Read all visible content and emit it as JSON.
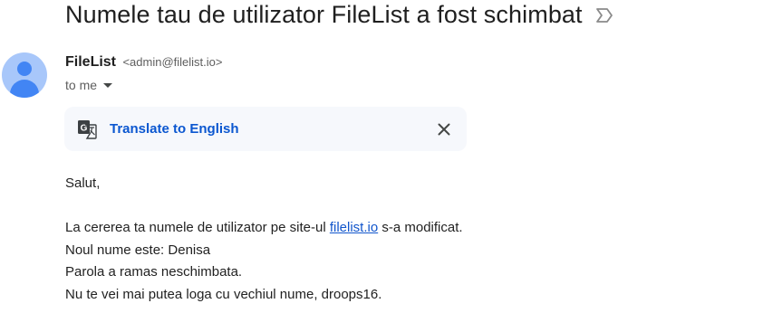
{
  "email": {
    "subject": "Numele tau de utilizator FileList a fost schimbat",
    "label_icon": "label-important-outline-icon",
    "sender": {
      "name": "FileList",
      "email": "<admin@filelist.io>",
      "avatar_icon": "default-person-avatar"
    },
    "recipient": "to me",
    "translate": {
      "icon": "translate-icon",
      "label": "Translate to English",
      "close_icon": "close-icon"
    },
    "body": {
      "greeting": "Salut,",
      "line1_before": "La cererea ta numele de utilizator pe site-ul ",
      "line1_link": "filelist.io",
      "line1_after": " s-a modificat.",
      "line2": "Noul nume este: Denisa",
      "line3": "Parola a ramas neschimbata.",
      "line4": "Nu te vei mai putea loga cu vechiul nume, droops16."
    }
  },
  "colors": {
    "link": "#1155cc",
    "translate_link": "#0b57d0",
    "translate_bg": "#f6f8fc",
    "avatar_bg": "#a8c7fa",
    "avatar_fg": "#4285f4"
  }
}
